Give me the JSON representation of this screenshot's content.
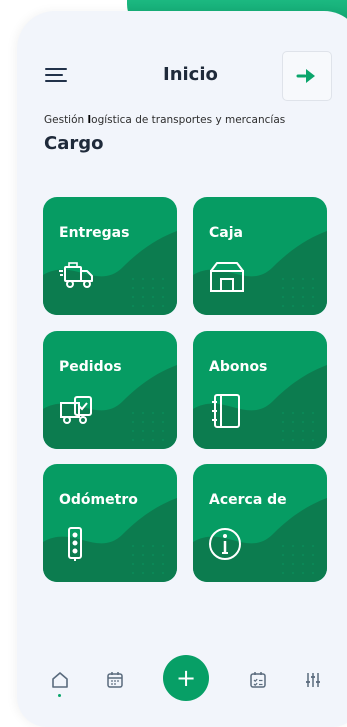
{
  "header": {
    "title": "Inicio"
  },
  "app": {
    "subtitle_prefix": "Gestión ",
    "subtitle_bold": "l",
    "subtitle_rest": "ogística de transportes y mercancías",
    "brand": "Cargo"
  },
  "cards": [
    {
      "label": "Entregas",
      "icon": "delivery-truck-icon"
    },
    {
      "label": "Caja",
      "icon": "box-icon"
    },
    {
      "label": "Pedidos",
      "icon": "truck-check-icon"
    },
    {
      "label": "Abonos",
      "icon": "notebook-icon"
    },
    {
      "label": "Odómetro",
      "icon": "odometer-icon"
    },
    {
      "label": "Acerca de",
      "icon": "info-icon"
    }
  ],
  "bottom_nav": {
    "fab_label": "+",
    "items": [
      "home-icon",
      "calendar-icon",
      "add-icon",
      "checklist-icon",
      "sliders-icon"
    ]
  },
  "colors": {
    "accent": "#069c63",
    "accent_dark": "#0c7c4f",
    "background": "#f2f5fb"
  }
}
